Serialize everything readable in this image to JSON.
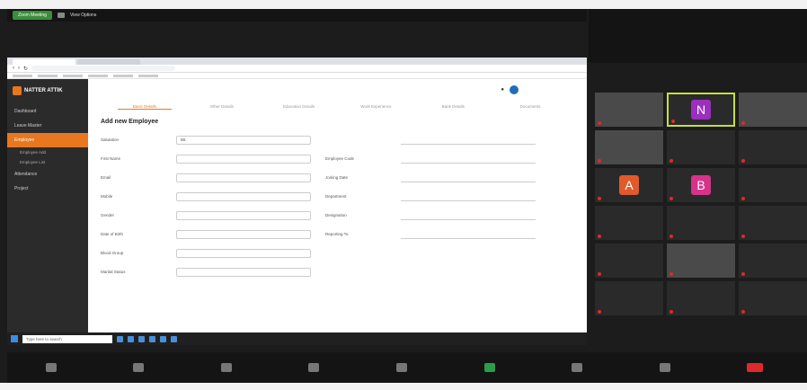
{
  "zoom": {
    "tab_label": "Zoom Meeting",
    "share_label": "View Options"
  },
  "browser": {
    "tab1": "",
    "tab2": "",
    "address": ""
  },
  "app": {
    "logo": "NATTER ATTIK",
    "sidebar": [
      {
        "label": "Dashboard",
        "active": false
      },
      {
        "label": "Leave Master",
        "active": false
      },
      {
        "label": "Employee",
        "active": true
      },
      {
        "label": "Employee Add",
        "active": false
      },
      {
        "label": "Employee List",
        "active": false
      },
      {
        "label": "Attendance",
        "active": false
      },
      {
        "label": "Project",
        "active": false
      }
    ],
    "header_user": "",
    "steps": [
      "Basic Details",
      "Other Details",
      "Education Details",
      "Work Experience",
      "Bank Details",
      "Documents"
    ],
    "section_title": "Add new Employee",
    "form_left": [
      {
        "label": "Salutation",
        "value": "Mr."
      },
      {
        "label": "First Name",
        "value": ""
      },
      {
        "label": "Email",
        "value": ""
      },
      {
        "label": "Mobile",
        "value": ""
      },
      {
        "label": "Gender",
        "value": ""
      },
      {
        "label": "Date of Birth",
        "value": ""
      },
      {
        "label": "Blood Group",
        "value": ""
      },
      {
        "label": "Marital Status",
        "value": ""
      }
    ],
    "form_right": [
      {
        "label": "",
        "value": ""
      },
      {
        "label": "Employee Code",
        "value": ""
      },
      {
        "label": "Joining Date",
        "value": ""
      },
      {
        "label": "Department",
        "value": ""
      },
      {
        "label": "Designation",
        "value": ""
      },
      {
        "label": "Reporting To",
        "value": ""
      },
      {
        "label": "",
        "value": ""
      },
      {
        "label": "",
        "value": ""
      }
    ]
  },
  "taskbar": {
    "search": "Type here to search",
    "time": ""
  },
  "participants": [
    {
      "name": "",
      "kind": "video",
      "initial": ""
    },
    {
      "name": "",
      "kind": "initial",
      "initial": "N",
      "color": "#9b2fbf",
      "highlight": true
    },
    {
      "name": "",
      "kind": "video",
      "initial": ""
    },
    {
      "name": "",
      "kind": "video",
      "initial": ""
    },
    {
      "name": "",
      "kind": "name",
      "initial": ""
    },
    {
      "name": "",
      "kind": "name",
      "initial": ""
    },
    {
      "name": "",
      "kind": "initial",
      "initial": "A",
      "color": "#e05a2b"
    },
    {
      "name": "",
      "kind": "initial",
      "initial": "B",
      "color": "#d6338a"
    },
    {
      "name": "",
      "kind": "name",
      "initial": ""
    },
    {
      "name": "",
      "kind": "name",
      "initial": ""
    },
    {
      "name": "",
      "kind": "name",
      "initial": ""
    },
    {
      "name": "",
      "kind": "name",
      "initial": ""
    },
    {
      "name": "",
      "kind": "name",
      "initial": ""
    },
    {
      "name": "",
      "kind": "video",
      "initial": ""
    },
    {
      "name": "",
      "kind": "name",
      "initial": ""
    },
    {
      "name": "",
      "kind": "name",
      "initial": ""
    },
    {
      "name": "",
      "kind": "name",
      "initial": ""
    },
    {
      "name": "",
      "kind": "name",
      "initial": ""
    }
  ]
}
